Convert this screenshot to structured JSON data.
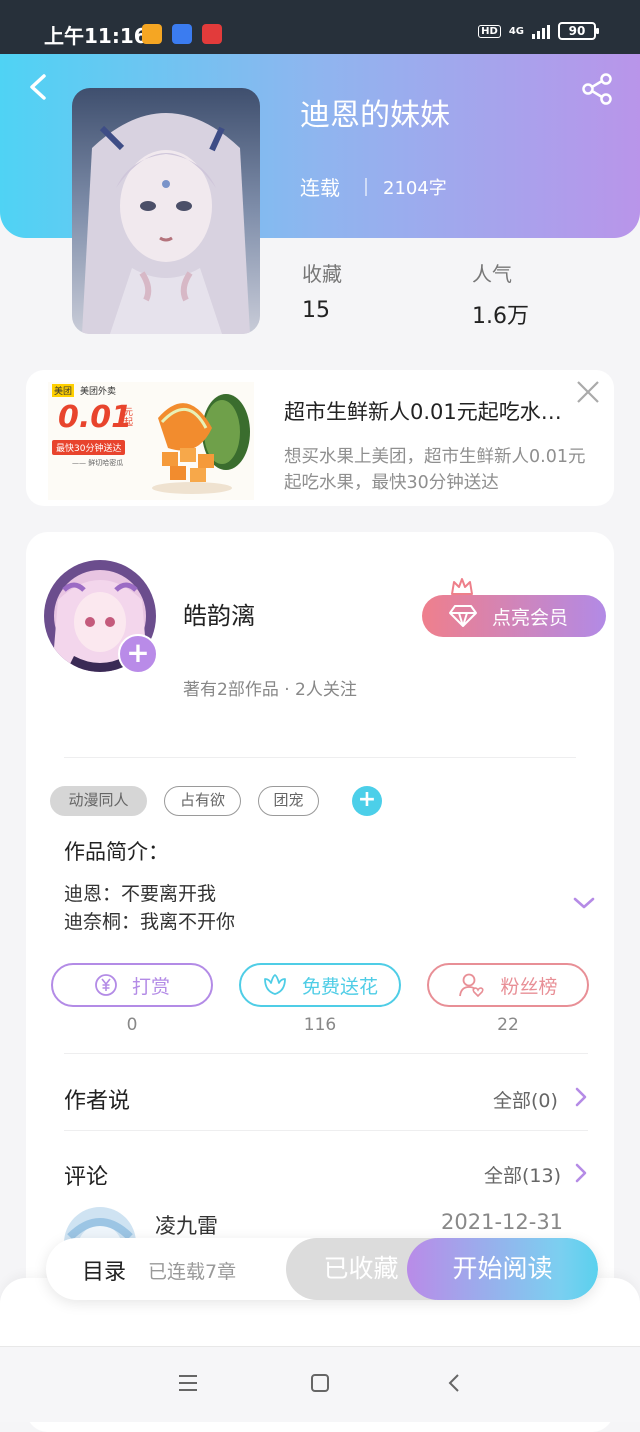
{
  "status_bar": {
    "time": "上午11:16",
    "hd": "HD",
    "network": "4G",
    "battery": "90"
  },
  "book": {
    "title": "迪恩的妹妹",
    "status": "连载",
    "word_count": "2104字",
    "stats": [
      {
        "label": "收藏",
        "value": "15"
      },
      {
        "label": "人气",
        "value": "1.6万"
      }
    ]
  },
  "ad": {
    "title": "超市生鲜新人0.01元起吃水…",
    "description": "想买水果上美团，超市生鲜新人0.01元起吃水果，最快30分钟送达",
    "image_brand": "美团",
    "image_brand2": "美团外卖",
    "image_price": "0.01",
    "image_price_unit": "元起",
    "image_badge": "最快30分钟送达",
    "image_caption": "—— 鲜切哈密瓜"
  },
  "author": {
    "name": "皓韵漓",
    "meta": "著有2部作品 · 2人关注",
    "vip_label": "点亮会员"
  },
  "tags": [
    "动漫同人",
    "占有欲",
    "团宠"
  ],
  "intro": {
    "heading": "作品简介：",
    "lines": [
      "迪恩：不要离开我",
      "迪奈桐：我离不开你"
    ]
  },
  "actions": [
    {
      "label": "打赏",
      "count": "0",
      "color": "#b38be6"
    },
    {
      "label": "免费送花",
      "count": "116",
      "color": "#4fcde6"
    },
    {
      "label": "粉丝榜",
      "count": "22",
      "color": "#e88f96"
    }
  ],
  "author_says": {
    "title": "作者说",
    "more": "全部(0)"
  },
  "comments": {
    "title": "评论",
    "more": "全部(13)",
    "first": {
      "user": "凌九雷",
      "date": "2021-12-31"
    }
  },
  "bottom_bar": {
    "toc": "目录",
    "toc_sub": "已连载7章",
    "collected": "已收藏",
    "start_reading": "开始阅读"
  },
  "colors": {
    "accent_purple": "#b98be8",
    "accent_cyan": "#4fd3f4",
    "vip_gradient_start": "#ef7f8c"
  }
}
